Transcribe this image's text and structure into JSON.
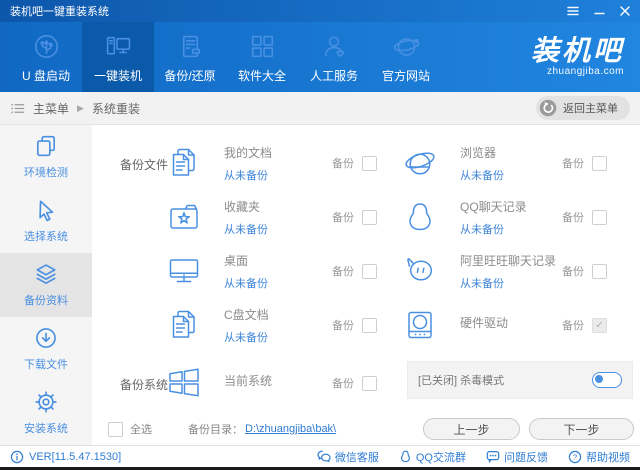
{
  "titlebar": {
    "title": "装机吧一键重装系统"
  },
  "nav": {
    "items": [
      {
        "label": "U 盘启动"
      },
      {
        "label": "一键装机"
      },
      {
        "label": "备份/还原"
      },
      {
        "label": "软件大全"
      },
      {
        "label": "人工服务"
      },
      {
        "label": "官方网站"
      }
    ],
    "logo": {
      "brand": "装机吧",
      "domain": "zhuangjiba.com"
    }
  },
  "breadcrumb": {
    "root": "主菜单",
    "current": "系统重装",
    "back_button": "返回主菜单"
  },
  "sidebar": {
    "items": [
      {
        "label": "环境检测"
      },
      {
        "label": "选择系统"
      },
      {
        "label": "备份资料"
      },
      {
        "label": "下载文件"
      },
      {
        "label": "安装系统"
      }
    ]
  },
  "main": {
    "backup_files_label": "备份文件",
    "backup_label": "备份",
    "items_left": [
      {
        "name": "我的文档",
        "status": "从未备份",
        "checked": false
      },
      {
        "name": "收藏夹",
        "status": "从未备份",
        "checked": false
      },
      {
        "name": "桌面",
        "status": "从未备份",
        "checked": false
      },
      {
        "name": "C盘文档",
        "status": "从未备份",
        "checked": false
      }
    ],
    "items_right": [
      {
        "name": "浏览器",
        "status": "从未备份",
        "checked": false
      },
      {
        "name": "QQ聊天记录",
        "status": "从未备份",
        "checked": false
      },
      {
        "name": "阿里旺旺聊天记录",
        "status": "从未备份",
        "checked": false
      },
      {
        "name": "硬件驱动",
        "status": "",
        "checked": true
      }
    ],
    "backup_system_label": "备份系统",
    "system_item": {
      "name": "当前系统",
      "status": "",
      "checked": false
    },
    "antivirus_label": "[已关闭] 杀毒模式",
    "select_all_label": "全选",
    "backup_dir_label": "备份目录：",
    "backup_dir": "D:\\zhuangjiba\\bak\\",
    "prev_button": "上一步",
    "next_button": "下一步"
  },
  "statusbar": {
    "version": "VER[11.5.47.1530]",
    "links": [
      {
        "label": "微信客服"
      },
      {
        "label": "QQ交流群"
      },
      {
        "label": "问题反馈"
      },
      {
        "label": "帮助视频"
      }
    ]
  },
  "colors": {
    "accent": "#4a90e2",
    "nav_blue": "#1778d3",
    "nav_active": "#0b5aa9",
    "link": "#2f7cd3"
  }
}
